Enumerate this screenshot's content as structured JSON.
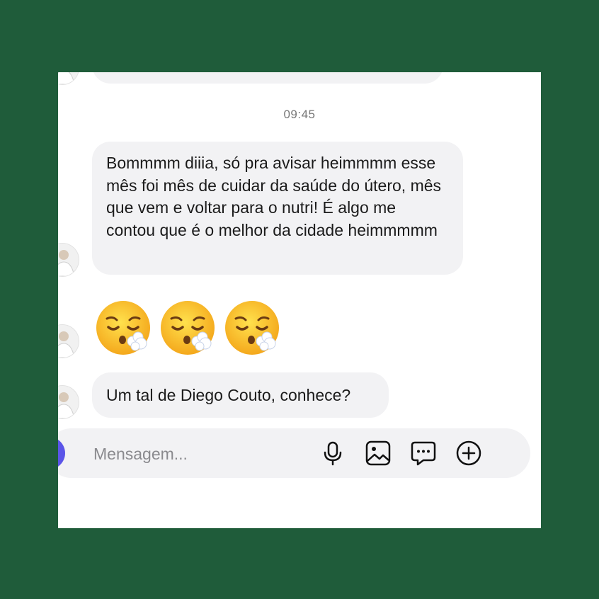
{
  "conversation": {
    "timestamp": "09:45",
    "messages": [
      {
        "text": "Bommmm diiia, só pra avisar heimmmm esse mês foi mês de cuidar da saúde do útero, mês que vem e voltar para o nutri! É algo me contou que é o melhor da cidade heimmmmm"
      },
      {
        "emojis": [
          "face-exhaling-emoji",
          "face-exhaling-emoji",
          "face-exhaling-emoji"
        ]
      },
      {
        "text": "Um tal de Diego Couto, conhece?"
      }
    ]
  },
  "composer": {
    "placeholder": "Mensagem...",
    "icons": [
      "camera-icon",
      "microphone-icon",
      "gallery-icon",
      "sticker-chat-icon",
      "add-icon"
    ]
  },
  "colors": {
    "frame": "#1f5c3a",
    "bubble": "#f2f2f4",
    "camera_button": "#5b55e8"
  }
}
